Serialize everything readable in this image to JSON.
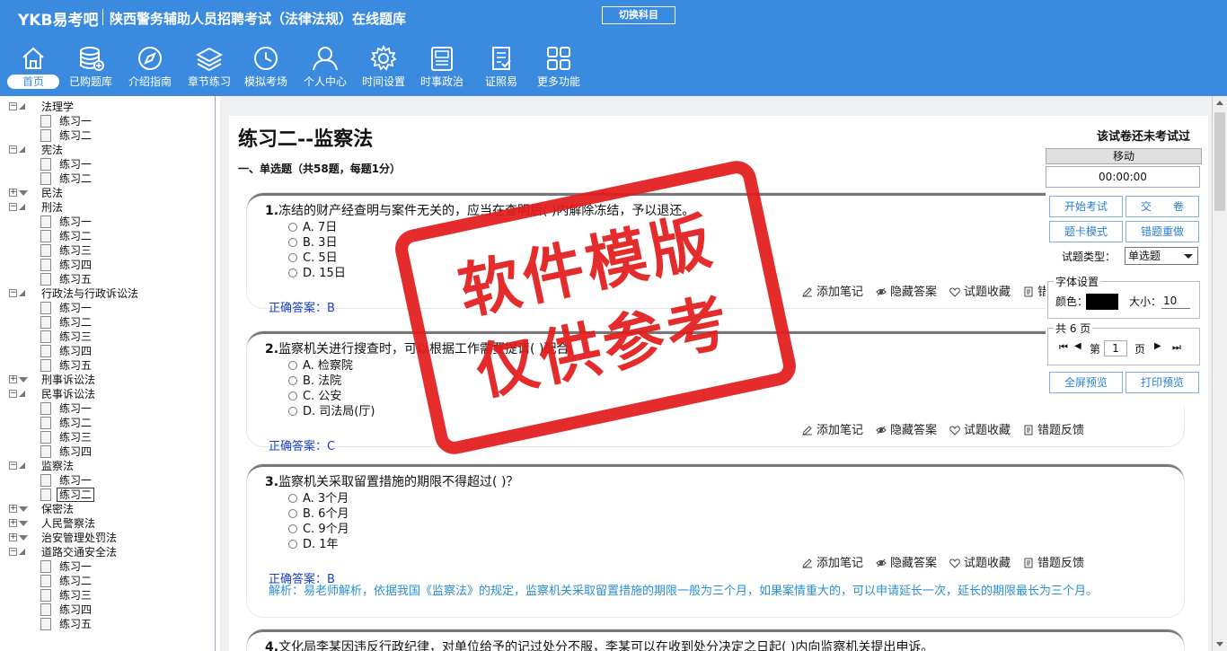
{
  "header": {
    "logo": "YKB易考吧",
    "title": "陕西警务辅助人员招聘考试（法律法规）在线题库",
    "switch_label": "切换科目"
  },
  "nav": {
    "items": [
      {
        "label": "首页",
        "icon": "home-icon"
      },
      {
        "label": "已购题库",
        "icon": "database-icon"
      },
      {
        "label": "介绍指南",
        "icon": "compass-icon"
      },
      {
        "label": "章节练习",
        "icon": "layers-icon"
      },
      {
        "label": "模拟考场",
        "icon": "clock-icon"
      },
      {
        "label": "个人中心",
        "icon": "user-icon"
      },
      {
        "label": "时间设置",
        "icon": "gear-icon"
      },
      {
        "label": "时事政治",
        "icon": "news-icon"
      },
      {
        "label": "证照易",
        "icon": "certificate-icon"
      },
      {
        "label": "更多功能",
        "icon": "grid-icon"
      }
    ]
  },
  "tree": {
    "rows": [
      {
        "type": "parent",
        "label": "法理学",
        "open": true
      },
      {
        "type": "child",
        "label": "练习一"
      },
      {
        "type": "child",
        "label": "练习二"
      },
      {
        "type": "parent",
        "label": "宪法",
        "open": true
      },
      {
        "type": "child",
        "label": "练习一"
      },
      {
        "type": "child",
        "label": "练习二"
      },
      {
        "type": "parent",
        "label": "民法",
        "open": false
      },
      {
        "type": "parent",
        "label": "刑法",
        "open": true
      },
      {
        "type": "child",
        "label": "练习一"
      },
      {
        "type": "child",
        "label": "练习二"
      },
      {
        "type": "child",
        "label": "练习三"
      },
      {
        "type": "child",
        "label": "练习四"
      },
      {
        "type": "child",
        "label": "练习五"
      },
      {
        "type": "parent",
        "label": "行政法与行政诉讼法",
        "open": true
      },
      {
        "type": "child",
        "label": "练习一"
      },
      {
        "type": "child",
        "label": "练习二"
      },
      {
        "type": "child",
        "label": "练习三"
      },
      {
        "type": "child",
        "label": "练习四"
      },
      {
        "type": "child",
        "label": "练习五"
      },
      {
        "type": "parent",
        "label": "刑事诉讼法",
        "open": false
      },
      {
        "type": "parent",
        "label": "民事诉讼法",
        "open": true
      },
      {
        "type": "child",
        "label": "练习一"
      },
      {
        "type": "child",
        "label": "练习二"
      },
      {
        "type": "child",
        "label": "练习三"
      },
      {
        "type": "child",
        "label": "练习四"
      },
      {
        "type": "parent",
        "label": "监察法",
        "open": true
      },
      {
        "type": "child",
        "label": "练习一"
      },
      {
        "type": "child",
        "label": "练习二",
        "selected": true
      },
      {
        "type": "parent",
        "label": "保密法",
        "open": false
      },
      {
        "type": "parent",
        "label": "人民警察法",
        "open": false
      },
      {
        "type": "parent",
        "label": "治安管理处罚法",
        "open": false
      },
      {
        "type": "parent",
        "label": "道路交通安全法",
        "open": true
      },
      {
        "type": "child",
        "label": "练习一"
      },
      {
        "type": "child",
        "label": "练习二"
      },
      {
        "type": "child",
        "label": "练习三"
      },
      {
        "type": "child",
        "label": "练习四"
      },
      {
        "type": "child",
        "label": "练习五"
      }
    ]
  },
  "exam": {
    "title": "练习二--监察法",
    "status": "该试卷还未考试过",
    "section": "一、单选题（共58题，每题1分）"
  },
  "questions": [
    {
      "num": "1.",
      "text": "冻结的财产经查明与案件无关的，应当在查明后(  )内解除冻结，予以退还。",
      "options": [
        "A. 7日",
        "B. 3日",
        "C. 5日",
        "D. 15日"
      ],
      "answer": "正确答案：B",
      "analysis": ""
    },
    {
      "num": "2.",
      "text": "监察机关进行搜查时，可以根据工作需要提请(  )配合。",
      "options": [
        "A. 检察院",
        "B. 法院",
        "C. 公安",
        "D. 司法局(厅)"
      ],
      "answer": "正确答案：C",
      "analysis": ""
    },
    {
      "num": "3.",
      "text": "监察机关采取留置措施的期限不得超过(  )？",
      "options": [
        "A. 3个月",
        "B. 6个月",
        "C. 9个月",
        "D. 1年"
      ],
      "answer": "正确答案：B",
      "analysis": "解析：易老师解析，依据我国《监察法》的规定，监察机关采取留置措施的期限一般为三个月，如果案情重大的，可以申请延长一次，延长的期限最长为三个月。"
    },
    {
      "num": "4.",
      "text": "文化局李某因违反行政纪律，对单位给予的记过处分不服，李某可以在收到处分决定之日起(  )内向监察机关提出申诉。"
    }
  ],
  "actions": {
    "note": "添加笔记",
    "hide": "隐藏答案",
    "fav": "试题收藏",
    "report": "错题反馈"
  },
  "panel": {
    "move": "移动",
    "timer": "00:00:00",
    "start": "开始考试",
    "submit": "交　　卷",
    "card_mode": "题卡模式",
    "redo": "错题重做",
    "type_label": "试题类型：",
    "type_value": "单选题",
    "font_legend": "字体设置",
    "color_label": "颜色：",
    "size_label": "大小：",
    "size_value": "10",
    "pages_legend": "共 6 页",
    "page_prefix": "第",
    "page_value": "1",
    "page_suffix": "页",
    "fullscreen": "全屏预览",
    "print": "打印预览"
  },
  "watermark": {
    "line1": "软件模版",
    "line2": "仅供参考",
    "color": "#e31b1b"
  }
}
